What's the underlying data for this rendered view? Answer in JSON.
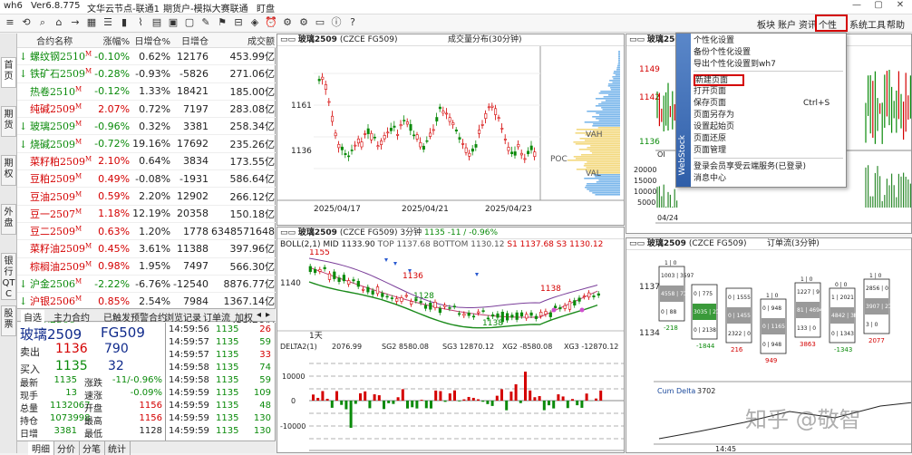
{
  "titlebar": {
    "app": "wh6",
    "version": "Ver6.8.775",
    "server": "文华云节点-联通1",
    "account": "期货户-模拟大赛联通",
    "mode": "盯盘"
  },
  "menu": [
    "板块",
    "账户",
    "资讯",
    "个性化",
    "系统工具",
    "帮助"
  ],
  "left_tabs": [
    "首页",
    "期货",
    "期权",
    "外盘",
    "银行QTC",
    "股票"
  ],
  "quote_table": {
    "headers": [
      "合约名称",
      "涨幅%",
      "日增仓%",
      "日增仓",
      "成交额"
    ],
    "expand": "»",
    "rows": [
      {
        "dir": "↓",
        "name": "螺纹钢2510",
        "tag": "M",
        "chg": "-0.10%",
        "oi_pct": "0.62%",
        "oi": "12176",
        "amt": "453.99亿",
        "c": "green"
      },
      {
        "dir": "↓",
        "name": "铁矿石2509",
        "tag": "M",
        "chg": "-0.28%",
        "oi_pct": "-0.93%",
        "oi": "-5826",
        "amt": "271.06亿",
        "c": "green"
      },
      {
        "dir": "",
        "name": "热卷2510",
        "tag": "M",
        "chg": "-0.12%",
        "oi_pct": "1.33%",
        "oi": "18421",
        "amt": "185.00亿",
        "c": "green"
      },
      {
        "dir": "",
        "name": "纯碱2509",
        "tag": "M",
        "chg": "2.07%",
        "oi_pct": "0.72%",
        "oi": "7197",
        "amt": "283.08亿",
        "c": "red"
      },
      {
        "dir": "↓",
        "name": "玻璃2509",
        "tag": "M",
        "chg": "-0.96%",
        "oi_pct": "0.32%",
        "oi": "3381",
        "amt": "258.34亿",
        "c": "green"
      },
      {
        "dir": "↓",
        "name": "烧碱2509",
        "tag": "M",
        "chg": "-0.72%",
        "oi_pct": "19.16%",
        "oi": "17692",
        "amt": "235.26亿",
        "c": "green"
      },
      {
        "dir": "",
        "name": "菜籽粕2509",
        "tag": "M",
        "chg": "2.10%",
        "oi_pct": "0.64%",
        "oi": "3834",
        "amt": "173.55亿",
        "c": "red"
      },
      {
        "dir": "",
        "name": "豆粕2509",
        "tag": "M",
        "chg": "0.49%",
        "oi_pct": "-0.08%",
        "oi": "-1931",
        "amt": "586.64亿",
        "c": "red"
      },
      {
        "dir": "",
        "name": "豆油2509",
        "tag": "M",
        "chg": "0.59%",
        "oi_pct": "2.20%",
        "oi": "12902",
        "amt": "266.12亿",
        "c": "red"
      },
      {
        "dir": "",
        "name": "豆一2507",
        "tag": "M",
        "chg": "1.18%",
        "oi_pct": "12.19%",
        "oi": "20358",
        "amt": "150.18亿",
        "c": "red"
      },
      {
        "dir": "",
        "name": "豆二2509",
        "tag": "M",
        "chg": "0.63%",
        "oi_pct": "1.20%",
        "oi": "1778",
        "amt": "6348571648",
        "c": "red"
      },
      {
        "dir": "",
        "name": "菜籽油2509",
        "tag": "M",
        "chg": "0.45%",
        "oi_pct": "3.61%",
        "oi": "11388",
        "amt": "397.96亿",
        "c": "red"
      },
      {
        "dir": "",
        "name": "棕榈油2509",
        "tag": "M",
        "chg": "0.98%",
        "oi_pct": "1.95%",
        "oi": "7497",
        "amt": "566.30亿",
        "c": "red"
      },
      {
        "dir": "↓",
        "name": "沪金2506",
        "tag": "M",
        "chg": "-2.22%",
        "oi_pct": "-6.76%",
        "oi": "-12540",
        "amt": "8876.77亿",
        "c": "green"
      },
      {
        "dir": "↓",
        "name": "沪银2506",
        "tag": "M",
        "chg": "0.85%",
        "oi_pct": "2.54%",
        "oi": "7984",
        "amt": "1367.14亿",
        "c": "red"
      },
      {
        "dir": "↓",
        "name": "沪铜2506",
        "tag": "M",
        "chg": "-0.45%",
        "oi_pct": "-2.88%",
        "oi": "-4919",
        "amt": "433.26亿",
        "c": "green"
      }
    ]
  },
  "quote_tabs": [
    "自选",
    "主力合约",
    "已触发预警合约",
    "浏览记录",
    "订单流",
    "加权"
  ],
  "detail": {
    "name": "玻璃2509",
    "code": "FG509",
    "sell_label": "卖出",
    "sell_price": "1136",
    "sell_vol": "790",
    "buy_label": "买入",
    "buy_price": "1135",
    "buy_vol": "32",
    "stats": [
      {
        "l1": "最新",
        "v1": "1135",
        "l2": "涨跌",
        "v2": "-11/-0.96%",
        "c2": "green"
      },
      {
        "l1": "现手",
        "v1": "13",
        "l2": "速涨",
        "v2": "-0.09%",
        "c2": "green"
      },
      {
        "l1": "总量",
        "v1": "1132067",
        "l2": "开盘",
        "v2": "1156",
        "c2": "red"
      },
      {
        "l1": "持仓",
        "v1": "1073998",
        "l2": "最高",
        "v2": "1156",
        "c2": "red"
      },
      {
        "l1": "日增",
        "v1": "3381",
        "l2": "最低",
        "v2": "1128",
        "c2": "blk"
      }
    ]
  },
  "ticks": [
    {
      "t": "14:59:56",
      "p": "1135",
      "v": "26",
      "c": "red"
    },
    {
      "t": "14:59:57",
      "p": "1135",
      "v": "59",
      "c": "green"
    },
    {
      "t": "14:59:57",
      "p": "1135",
      "v": "33",
      "c": "red"
    },
    {
      "t": "14:59:58",
      "p": "1135",
      "v": "74",
      "c": "green"
    },
    {
      "t": "14:59:58",
      "p": "1135",
      "v": "59",
      "c": "green"
    },
    {
      "t": "14:59:59",
      "p": "1135",
      "v": "109",
      "c": "green"
    },
    {
      "t": "14:59:59",
      "p": "1135",
      "v": "48",
      "c": "green"
    },
    {
      "t": "14:59:59",
      "p": "1135",
      "v": "130",
      "c": "green"
    },
    {
      "t": "14:59:59",
      "p": "1135",
      "v": "130",
      "c": "green"
    }
  ],
  "bottom_tabs": [
    "明细",
    "分价",
    "分笔",
    "统计"
  ],
  "panel_volume_profile": {
    "symbol": "玻璃2509",
    "code": "(CZCE FG509)",
    "title": "成交量分布(30分钟)",
    "y_labels": [
      "1161",
      "1136"
    ],
    "x_labels": [
      "2025/04/17",
      "2025/04/21",
      "2025/04/23"
    ],
    "vah": "VAH",
    "poc": "POC",
    "val": "VAL"
  },
  "panel_boll": {
    "symbol": "玻璃2509",
    "code": "(CZCE FG509)",
    "period": "3分钟",
    "price": "1135",
    "change": "-11 / -0.96%",
    "indicator": "BOLL(2,1)",
    "mid": "MID 1133.90",
    "top": "TOP 1137.68",
    "bottom": "BOTTOM 1130.12",
    "s1": "S1 1137.68",
    "s3": "S3 1130.12",
    "labels": [
      "1155",
      "1136",
      "1138",
      "1128",
      "1138"
    ],
    "y_label": "1140",
    "period_label": "1天"
  },
  "panel_delta": {
    "indicator": "DELTA2(1)",
    "value": "2076.99",
    "sg2": "SG2 8580.08",
    "sg3": "SG3 12870.12",
    "xg2": "XG2 -8580.08",
    "xg3": "XG3 -12870.12",
    "y_labels": [
      "10000",
      "0",
      "-10000"
    ],
    "x_labels": [
      "10:00",
      "14:00"
    ]
  },
  "panel_topright": {
    "symbol": "玻璃2509",
    "y_labels": [
      "1149",
      "1142",
      "1136"
    ],
    "y_labels2": [
      "20000",
      "15000",
      "10000",
      "5000"
    ],
    "oi_label": "OI",
    "date": "04/24"
  },
  "panel_orderflow": {
    "symbol": "玻璃2509",
    "code": "(CZCE FG509)",
    "title": "订单流(3分钟)",
    "y_labels": [
      "1137",
      "1134"
    ],
    "cum_delta_label": "Cum Delta",
    "cum_delta_value": "3702",
    "x_label": "14:45",
    "cols": [
      {
        "top": "1 | 0",
        "cells": [
          "1003 | 3597",
          "4558 | 7115",
          "0 | 88"
        ],
        "delta": "-218",
        "dc": "green"
      },
      {
        "top": "",
        "cells": [
          "0 | 775",
          "3035 | 2148",
          "0 | 2138"
        ],
        "delta": "-1844",
        "dc": "green"
      },
      {
        "top": "",
        "cells": [
          "0 | 1555",
          "0 | 1455",
          "2322 | 0"
        ],
        "delta": "216",
        "dc": "red"
      },
      {
        "top": "1 | 0",
        "cells": [
          "0 | 948",
          "0 | 1165",
          "0 | 948"
        ],
        "delta": "949",
        "dc": "red"
      },
      {
        "top": "1 | 0",
        "cells": [
          "1227 | 9",
          "81 | 4694",
          "133 | 0"
        ],
        "delta": "3863",
        "dc": "red"
      },
      {
        "top": "0 | 0",
        "cells": [
          "1 | 2021",
          "4842 | 380",
          "0 | 1343"
        ],
        "delta": "-1343",
        "dc": "green"
      },
      {
        "top": "1 | 0",
        "cells": [
          "2856 | 0",
          "3907 | 2148",
          "3 | 0"
        ],
        "delta": "2077",
        "dc": "red"
      }
    ]
  },
  "dropdown": {
    "items": [
      {
        "label": "个性化设置",
        "shortcut": ""
      },
      {
        "label": "备份个性化设置",
        "shortcut": ""
      },
      {
        "label": "导出个性化设置到wh7",
        "shortcut": ""
      },
      {
        "label": "新建页面",
        "shortcut": ""
      },
      {
        "label": "打开页面",
        "shortcut": ""
      },
      {
        "label": "保存页面",
        "shortcut": "Ctrl+S"
      },
      {
        "label": "页面另存为",
        "shortcut": ""
      },
      {
        "label": "设置起始页",
        "shortcut": ""
      },
      {
        "label": "页面还原",
        "shortcut": ""
      },
      {
        "label": "页面管理",
        "shortcut": ""
      },
      {
        "label": "登录会员享受云端服务(已登录)",
        "shortcut": ""
      },
      {
        "label": "消息中心",
        "shortcut": ""
      }
    ],
    "stripe": "WebStock"
  },
  "watermark": "知乎 @敬智",
  "colors": {
    "up": "#d40000",
    "down": "#0a8a0a",
    "highlight": "#d40000",
    "accent": "#2f5ea8"
  }
}
